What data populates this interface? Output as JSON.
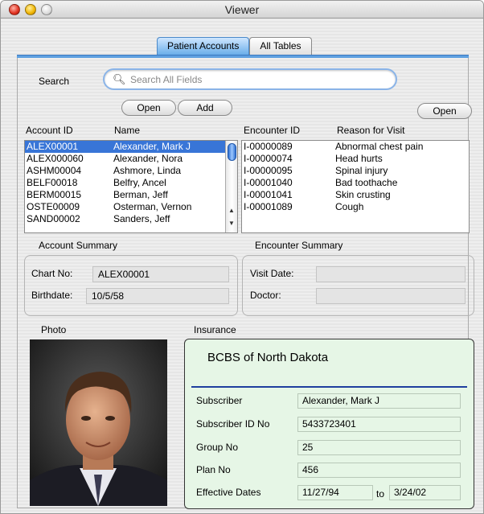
{
  "window": {
    "title": "Viewer"
  },
  "tabs": [
    {
      "label": "Patient Accounts",
      "active": true
    },
    {
      "label": "All Tables",
      "active": false
    }
  ],
  "search": {
    "label": "Search",
    "placeholder": "Search All Fields"
  },
  "buttons": {
    "open_accounts": "Open",
    "add_account": "Add",
    "open_encounter": "Open"
  },
  "accounts": {
    "headers": {
      "id": "Account ID",
      "name": "Name"
    },
    "rows": [
      {
        "id": "ALEX00001",
        "name": "Alexander, Mark J",
        "selected": true
      },
      {
        "id": "ALEX000060",
        "name": "Alexander, Nora",
        "selected": false
      },
      {
        "id": "ASHM00004",
        "name": "Ashmore, Linda",
        "selected": false
      },
      {
        "id": "BELF00018",
        "name": "Belfry, Ancel",
        "selected": false
      },
      {
        "id": "BERM00015",
        "name": "Berman, Jeff",
        "selected": false
      },
      {
        "id": "OSTE00009",
        "name": "Osterman, Vernon",
        "selected": false
      },
      {
        "id": "SAND00002",
        "name": "Sanders, Jeff",
        "selected": false
      }
    ]
  },
  "encounters": {
    "headers": {
      "id": "Encounter ID",
      "reason": "Reason for Visit"
    },
    "rows": [
      {
        "id": "I-00000089",
        "reason": "Abnormal chest pain"
      },
      {
        "id": "I-00000074",
        "reason": "Head hurts"
      },
      {
        "id": "I-00000095",
        "reason": "Spinal injury"
      },
      {
        "id": "I-00001040",
        "reason": "Bad toothache"
      },
      {
        "id": "I-00001041",
        "reason": "Skin crusting"
      },
      {
        "id": "I-00001089",
        "reason": "Cough"
      }
    ]
  },
  "account_summary": {
    "title": "Account Summary",
    "chart_label": "Chart No:",
    "chart_value": "ALEX00001",
    "birth_label": "Birthdate:",
    "birth_value": "10/5/58"
  },
  "encounter_summary": {
    "title": "Encounter Summary",
    "visit_label": "Visit Date:",
    "visit_value": "",
    "doctor_label": "Doctor:",
    "doctor_value": ""
  },
  "photo": {
    "label": "Photo"
  },
  "insurance": {
    "label": "Insurance",
    "carrier": "BCBS of North Dakota",
    "subscriber_label": "Subscriber",
    "subscriber_value": "Alexander, Mark J",
    "subscriber_id_label": "Subscriber ID No",
    "subscriber_id_value": "5433723401",
    "group_label": "Group No",
    "group_value": "25",
    "plan_label": "Plan No",
    "plan_value": "456",
    "dates_label": "Effective Dates",
    "date_from": "11/27/94",
    "date_to_sep": "to",
    "date_to": "3/24/02"
  },
  "colors": {
    "selection": "#3875d7",
    "tab_active": "#6aaeea",
    "insurance_bg": "#e6f6e6",
    "insurance_rule": "#1f3f9f"
  }
}
